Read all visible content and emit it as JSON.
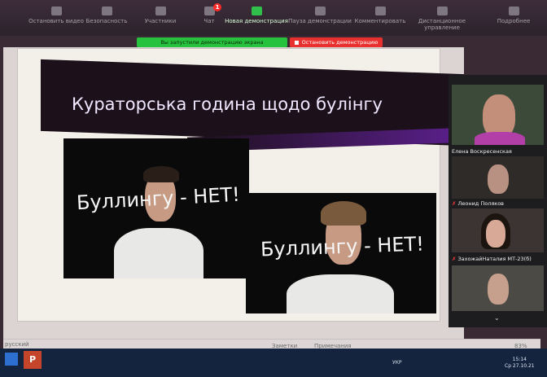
{
  "toolbar": {
    "items": [
      {
        "label": "Остановить видео",
        "icon": "video-icon"
      },
      {
        "label": "Безопасность",
        "icon": "shield-icon"
      },
      {
        "label": "Участники",
        "icon": "participants-icon"
      },
      {
        "label": "Чат",
        "icon": "chat-icon",
        "badge": "1"
      },
      {
        "label": "Новая демонстрация",
        "icon": "share-screen-icon"
      },
      {
        "label": "Пауза демонстрации",
        "icon": "pause-icon"
      },
      {
        "label": "Комментировать",
        "icon": "annotate-icon"
      },
      {
        "label": "Дистанционное управление",
        "icon": "remote-control-icon"
      },
      {
        "label": "Подробнее",
        "icon": "more-icon"
      }
    ]
  },
  "sharing": {
    "banner": "Вы запустили демонстрацию экрана",
    "stop_label": "Остановить демонстрацию"
  },
  "slide": {
    "title": "Кураторська година щодо булінгу",
    "photo1_text": "Буллингу - НЕТ!",
    "photo2_text": "Буллингу - НЕТ!"
  },
  "participants": [
    {
      "name": "Елена Воскресенская",
      "muted": false
    },
    {
      "name": "Леонид Поляков",
      "muted": true
    },
    {
      "name": "ЗахожайНаталия МТ-23(б)",
      "muted": true
    }
  ],
  "ppt_status": {
    "language": "русский",
    "notes": "Заметки",
    "comments": "Примечания",
    "zoom": "83%"
  },
  "taskbar": {
    "app": "P",
    "language": "УКР",
    "time": "15:14",
    "date": "Ср 27.10.21"
  },
  "colors": {
    "share_green": "#27c23d",
    "stop_red": "#e8312f",
    "slide_title_purple": "#5a1f8a"
  }
}
